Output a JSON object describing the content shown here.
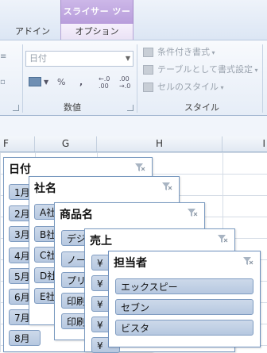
{
  "ribbon": {
    "contextual_tab_group": "スライサー ツール",
    "tabs": [
      {
        "label": "アドイン"
      },
      {
        "label": "オプション"
      }
    ],
    "number_group": {
      "label": "数値",
      "format_value": "日付",
      "percent": "%",
      "comma": ",",
      "increase_decimal": "←.0\n.00",
      "decrease_decimal": ".00\n→.0"
    },
    "styles_group": {
      "label": "スタイル",
      "conditional_formatting": "条件付き書式",
      "format_as_table": "テーブルとして書式設定",
      "cell_styles": "セルのスタイル"
    }
  },
  "grid": {
    "columns": [
      "F",
      "G",
      "H",
      "I"
    ]
  },
  "slicers": [
    {
      "title": "日付",
      "items": [
        "1月",
        "2月",
        "3月",
        "4月",
        "5月",
        "6月",
        "7月",
        "8月"
      ]
    },
    {
      "title": "社名",
      "items": [
        "A社",
        "B社",
        "C社",
        "D社",
        "E社"
      ]
    },
    {
      "title": "商品名",
      "items": [
        "デジ",
        "ノー",
        "プリ",
        "印刷",
        "印刷"
      ]
    },
    {
      "title": "売上",
      "items": [
        "¥",
        "¥",
        "¥",
        "¥",
        "¥",
        "¥"
      ]
    },
    {
      "title": "担当者",
      "items": [
        "エックスピー",
        "セブン",
        "ビスタ"
      ]
    }
  ],
  "colors": {
    "contextual_accent": "#b89ddb",
    "slicer_item_fill": "#b6c8e0",
    "slicer_border": "#7a9ac0"
  }
}
